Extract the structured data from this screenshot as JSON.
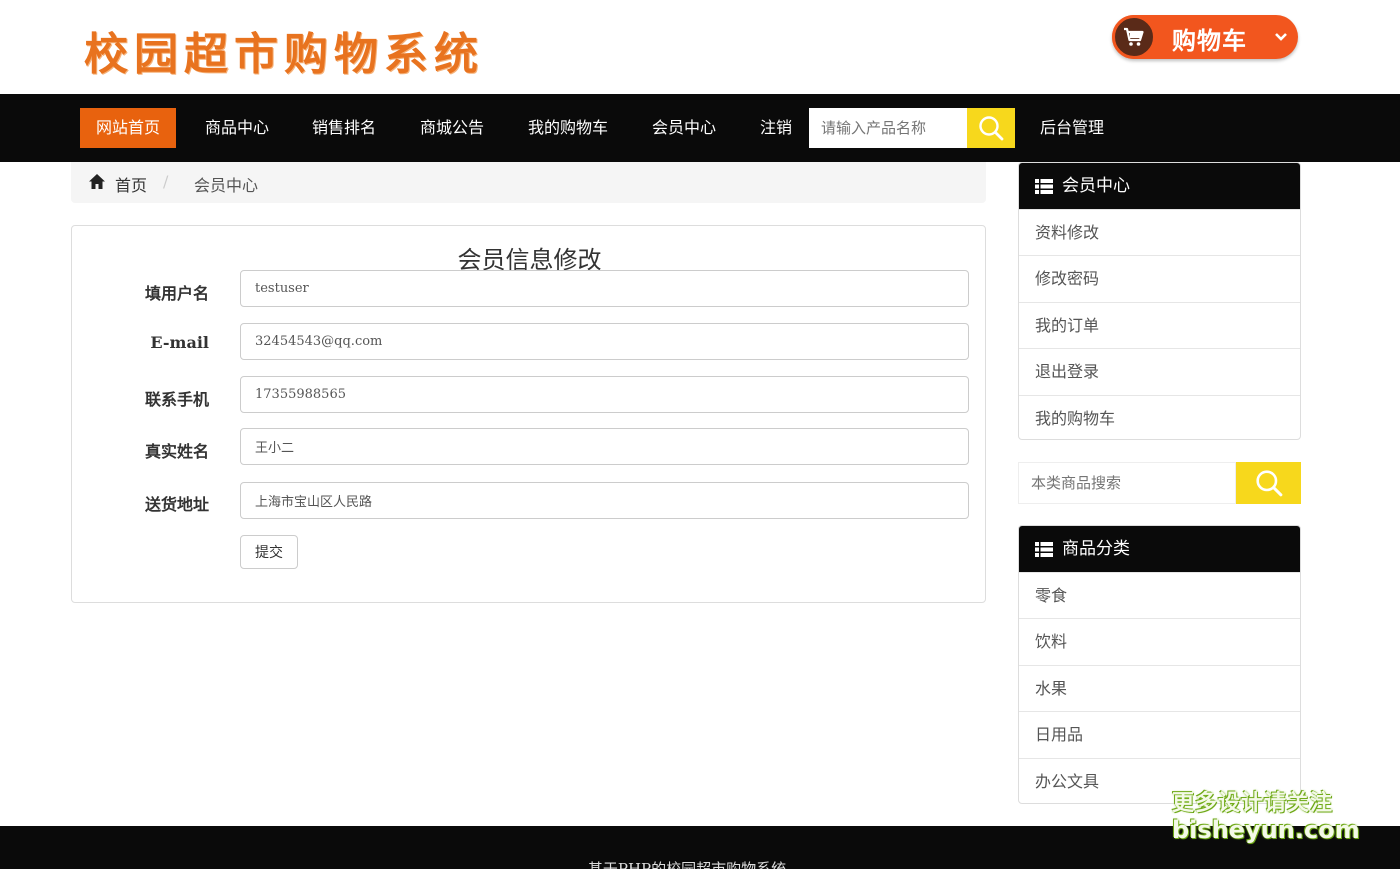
{
  "header": {
    "logo_text": "校园超市购物系统",
    "cart_label": "购物车",
    "cart_chevron": "⌄"
  },
  "nav": {
    "items": [
      "网站首页",
      "商品中心",
      "销售排名",
      "商城公告",
      "我的购物车",
      "会员中心",
      "注销"
    ],
    "search_placeholder": "请输入产品名称",
    "admin_label": "后台管理"
  },
  "breadcrumb": {
    "home": "首页",
    "separator": "/",
    "current": "会员中心"
  },
  "form": {
    "title": "会员信息修改",
    "fields": [
      {
        "label": "填用户名",
        "value": "testuser"
      },
      {
        "label": "E-mail",
        "value": "32454543@qq.com"
      },
      {
        "label": "联系手机",
        "value": "17355988565"
      },
      {
        "label": "真实姓名",
        "value": "王小二"
      },
      {
        "label": "送货地址",
        "value": "上海市宝山区人民路"
      }
    ],
    "submit_label": "提交"
  },
  "sidebar": {
    "member": {
      "title": "会员中心",
      "items": [
        "资料修改",
        "修改密码",
        "我的订单",
        "退出登录",
        "我的购物车"
      ]
    },
    "search_placeholder": "本类商品搜索",
    "categories": {
      "title": "商品分类",
      "items": [
        "零食",
        "饮料",
        "水果",
        "日用品",
        "办公文具"
      ]
    }
  },
  "footer": {
    "text": "基于PHP的校园超市购物系统"
  },
  "watermark": {
    "line1": "更多设计请关注",
    "line2": "bisheyun.com"
  },
  "colors": {
    "accent_orange": "#e8620e",
    "logo_orange": "#e8731f",
    "search_yellow": "#f7d81c",
    "nav_black": "#0a0a0a"
  }
}
